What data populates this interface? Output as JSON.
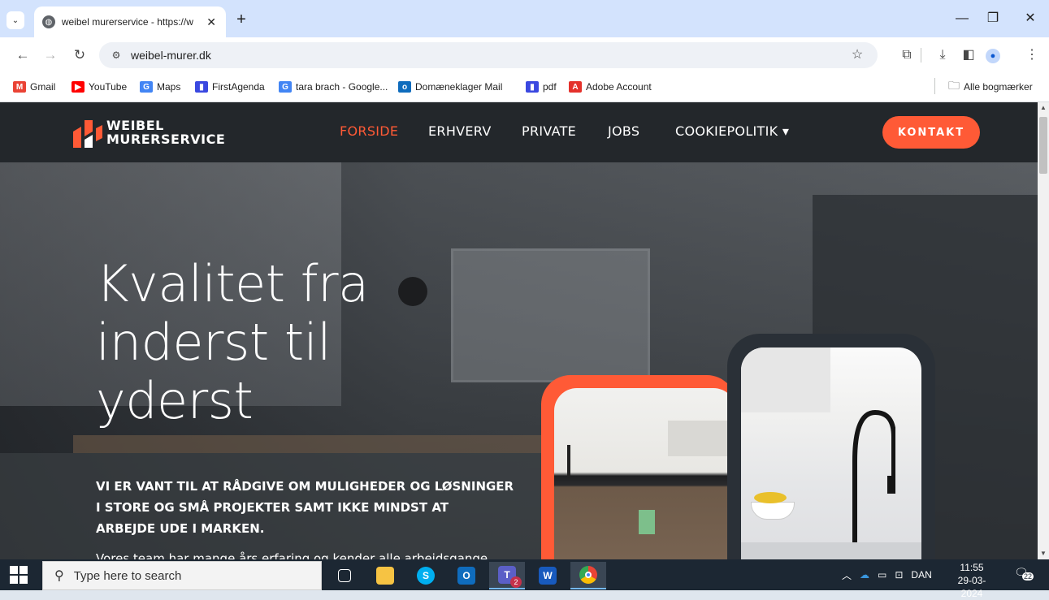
{
  "browser": {
    "tab_title": "weibel murerservice - https://w",
    "tab_close": "✕",
    "new_tab": "+",
    "url": "weibel-murer.dk",
    "window_controls": {
      "minimize": "—",
      "restore": "❐",
      "close": "✕"
    },
    "bookmarks": [
      {
        "label": "Gmail",
        "icon": "gmail-icon",
        "color": "#ea4335",
        "glyph": "M"
      },
      {
        "label": "YouTube",
        "icon": "youtube-icon",
        "color": "#ff0000",
        "glyph": "▶"
      },
      {
        "label": "Maps",
        "icon": "google-icon",
        "color": "#4285f4",
        "glyph": "G"
      },
      {
        "label": "FirstAgenda",
        "icon": "firstagenda-icon",
        "color": "#3a48e0",
        "glyph": "▮"
      },
      {
        "label": "tara brach - Google...",
        "icon": "google-icon",
        "color": "#4285f4",
        "glyph": "G"
      },
      {
        "label": "Domæneklager Mail",
        "icon": "outlook-icon",
        "color": "#0f6cbd",
        "glyph": "o"
      },
      {
        "label": "pdf",
        "icon": "pdf-icon",
        "color": "#3a48e0",
        "glyph": "▮"
      },
      {
        "label": "Adobe Account",
        "icon": "adobe-icon",
        "color": "#e4312b",
        "glyph": "A"
      }
    ],
    "all_bookmarks": "Alle bogmærker"
  },
  "site": {
    "logo_line1": "WEIBEL",
    "logo_line2": "MURERSERVICE",
    "nav": [
      {
        "label": "FORSIDE",
        "active": true
      },
      {
        "label": "ERHVERV"
      },
      {
        "label": "PRIVATE"
      },
      {
        "label": "JOBS"
      },
      {
        "label": "COOKIEPOLITIK ▾"
      }
    ],
    "cta": "KONTAKT",
    "accent_color": "#ff5a36",
    "hero_heading_1": "Kvalitet fra",
    "hero_heading_2": "inderst til",
    "hero_heading_3": "yderst",
    "hero_sub_1": "VI ER VANT TIL AT RÅDGIVE OM MULIGHEDER OG LØSNINGER",
    "hero_sub_2": "I STORE OG SMÅ PROJEKTER SAMT IKKE MINDST AT",
    "hero_sub_3": "ARBEJDE UDE I MARKEN.",
    "hero_body": "Vores team har mange års erfaring og kender alle arbejdsgange"
  },
  "taskbar": {
    "search_placeholder": "Type here to search",
    "apps": [
      "task-view-icon",
      "file-explorer-icon",
      "skype-icon",
      "outlook-icon",
      "teams-icon",
      "word-icon",
      "chrome-icon"
    ],
    "teams_badge": "2",
    "language": "DAN",
    "time": "11:55",
    "date": "29-03-2024",
    "notifications": "22"
  }
}
